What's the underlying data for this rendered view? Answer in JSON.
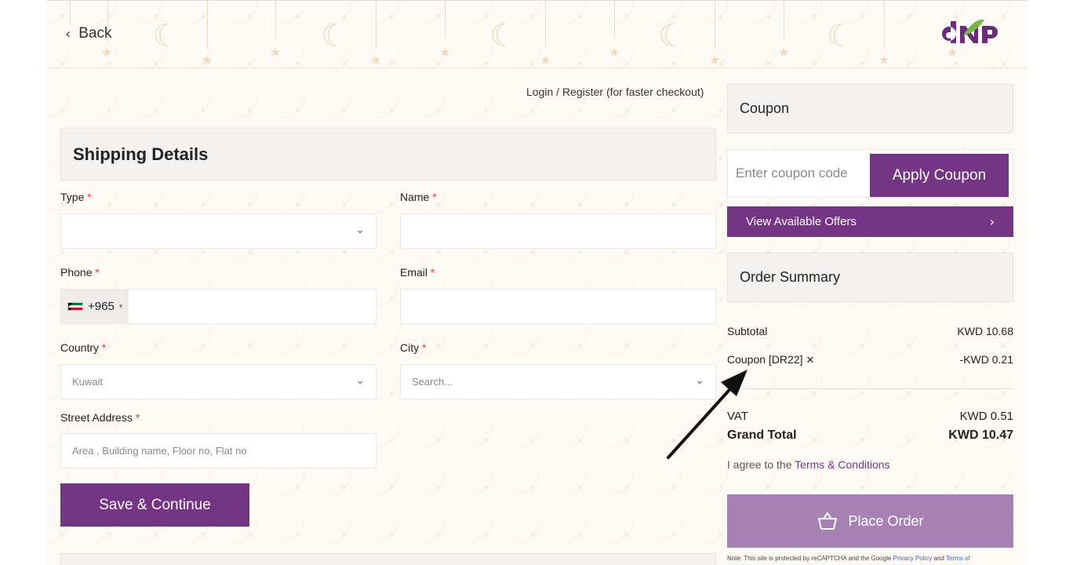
{
  "header": {
    "back_label": "Back",
    "logo_alt": "dnp-logo"
  },
  "login_link": "Login / Register (for faster checkout)",
  "shipping": {
    "title": "Shipping Details",
    "type_label": "Type",
    "name_label": "Name",
    "phone_label": "Phone",
    "phone_code": "+965",
    "email_label": "Email",
    "country_label": "Country",
    "country_value": "Kuwait",
    "city_label": "City",
    "city_placeholder": "Search...",
    "street_label": "Street Address",
    "street_placeholder": "Area , Building name, Floor no, Flat no",
    "required_mark": "*",
    "save_label": "Save & Continue"
  },
  "coupon": {
    "title": "Coupon",
    "placeholder": "Enter coupon code",
    "apply_label": "Apply Coupon",
    "offers_label": "View Available Offers"
  },
  "summary": {
    "title": "Order Summary",
    "subtotal_label": "Subtotal",
    "subtotal_value": "KWD 10.68",
    "coupon_label": "Coupon [DR22]",
    "coupon_value": "-KWD 0.21",
    "vat_label": "VAT",
    "vat_value": "KWD 0.51",
    "grand_label": "Grand Total",
    "grand_value": "KWD 10.47",
    "agree_prefix": "I agree to the",
    "agree_link": "Terms & Conditions",
    "place_label": "Place Order",
    "note_prefix": "Note: This site is protected by reCAPTCHA and the Google",
    "note_privacy": "Privacy Policy",
    "note_and": "and",
    "note_terms": "Terms of"
  },
  "colors": {
    "brand_purple": "#743584",
    "place_order_disabled": "#a881b4",
    "required_red": "#e23b3b"
  }
}
